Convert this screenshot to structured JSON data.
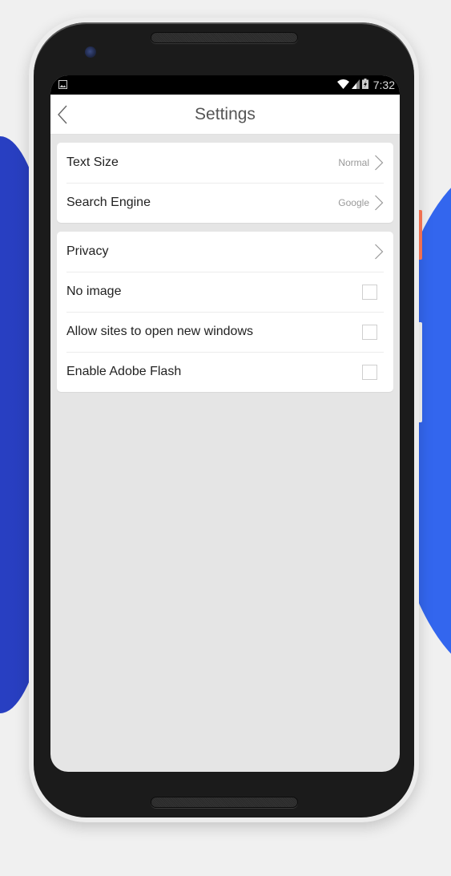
{
  "status_bar": {
    "left_icon": "image-notification-icon",
    "icons": [
      "wifi-icon",
      "signal-icon",
      "battery-charging-icon"
    ],
    "time": "7:32"
  },
  "header": {
    "back_icon": "chevron-left-icon",
    "title": "Settings"
  },
  "groups": [
    {
      "items": [
        {
          "label": "Text Size",
          "value": "Normal",
          "control": "chevron"
        },
        {
          "label": "Search Engine",
          "value": "Google",
          "control": "chevron"
        }
      ]
    },
    {
      "items": [
        {
          "label": "Privacy",
          "value": "",
          "control": "chevron"
        },
        {
          "label": "No image",
          "control": "checkbox",
          "checked": false
        },
        {
          "label": "Allow sites to open new windows",
          "control": "checkbox",
          "checked": false
        },
        {
          "label": "Enable Adobe Flash",
          "control": "checkbox",
          "checked": false
        }
      ]
    }
  ],
  "colors": {
    "accent_blue": "#3366ee",
    "power_button": "#f07050"
  }
}
